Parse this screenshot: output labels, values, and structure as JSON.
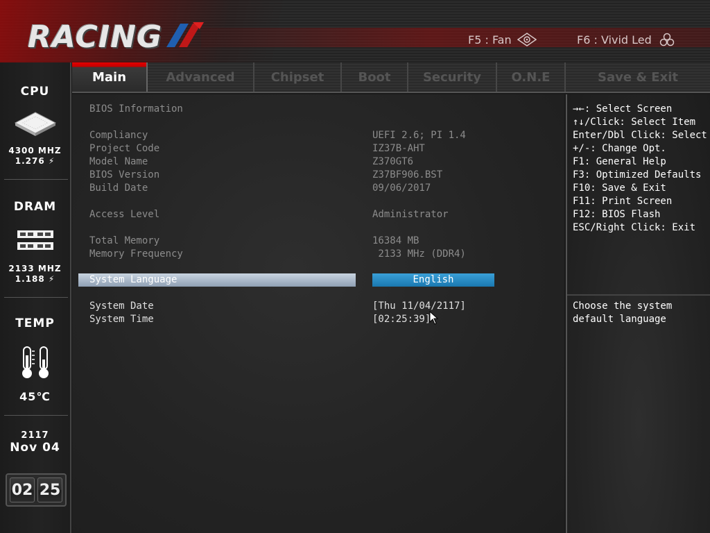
{
  "header": {
    "logo_text": "RACING",
    "hotkey_fan": "F5 : Fan",
    "hotkey_led": "F6 : Vivid Led"
  },
  "sidebar": {
    "cpu": {
      "title": "CPU",
      "freq": "4300 MHZ",
      "volt": "1.276 ⚡"
    },
    "dram": {
      "title": "DRAM",
      "freq": "2133 MHZ",
      "volt": "1.188 ⚡"
    },
    "temp": {
      "title": "TEMP",
      "value": "45℃"
    },
    "date": {
      "year": "2117",
      "month_day": "Nov 04"
    },
    "clock": {
      "hour": "02",
      "minute": "25"
    }
  },
  "tabs": [
    {
      "label": "Main",
      "active": true
    },
    {
      "label": "Advanced"
    },
    {
      "label": "Chipset"
    },
    {
      "label": "Boot"
    },
    {
      "label": "Security"
    },
    {
      "label": "O.N.E"
    },
    {
      "label": "Save & Exit"
    }
  ],
  "main": {
    "section_title": "BIOS Information",
    "rows": [
      {
        "label": "Compliancy",
        "value": "UEFI 2.6; PI 1.4"
      },
      {
        "label": "Project Code",
        "value": "IZ37B-AHT"
      },
      {
        "label": "Model Name",
        "value": "Z370GT6"
      },
      {
        "label": "BIOS Version",
        "value": "Z37BF906.BST"
      },
      {
        "label": "Build Date",
        "value": "09/06/2017"
      },
      {
        "label": "Access Level",
        "value": "Administrator"
      },
      {
        "label": "Total Memory",
        "value": "16384 MB"
      },
      {
        "label": "Memory Frequency",
        "value": " 2133 MHz (DDR4)"
      }
    ],
    "system_language": {
      "label": "System Language",
      "value": "English"
    },
    "system_date": {
      "label": "System Date",
      "value": "[Thu 11/04/2117]"
    },
    "system_time": {
      "label": "System Time",
      "value": "[02:25:39]"
    }
  },
  "help": {
    "keys": [
      "→←: Select Screen",
      "↑↓/Click: Select Item",
      "Enter/Dbl Click: Select",
      "+/-: Change Opt.",
      "F1: General Help",
      "F3: Optimized Defaults",
      "F10: Save & Exit",
      "F11: Print Screen",
      "F12: BIOS Flash",
      "ESC/Right Click: Exit"
    ],
    "description": [
      "Choose the system",
      "default language"
    ]
  },
  "colors": {
    "active_tab": "#e60000",
    "language_value": "#1a78b0",
    "highlight_bar": "#8fa0b4"
  }
}
